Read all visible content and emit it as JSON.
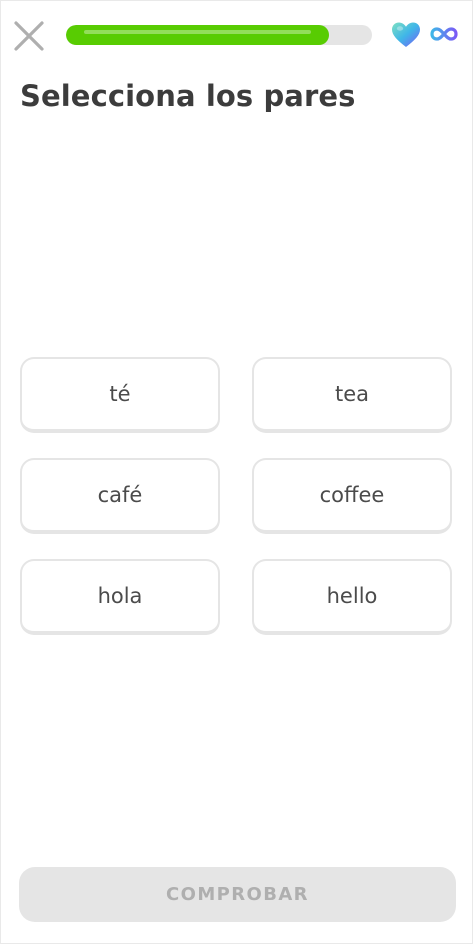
{
  "header": {
    "close_icon": "close-icon",
    "progress": 0.86,
    "progress_color": "#58cc02",
    "hearts_icon": "heart-icon",
    "hearts_value_icon": "infinity-icon"
  },
  "prompt": {
    "title": "Selecciona los pares"
  },
  "pairs": {
    "left": [
      {
        "label": "té"
      },
      {
        "label": "café"
      },
      {
        "label": "hola"
      }
    ],
    "right": [
      {
        "label": "tea"
      },
      {
        "label": "coffee"
      },
      {
        "label": "hello"
      }
    ]
  },
  "footer": {
    "check_label": "COMPROBAR",
    "check_enabled": false
  }
}
